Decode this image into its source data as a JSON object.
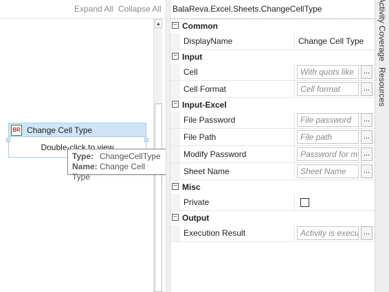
{
  "designer": {
    "expand_all": "Expand All",
    "collapse_all": "Collapse All",
    "activity": {
      "icon_text": "BR",
      "title": "Change Cell Type",
      "body": "Double-click to view"
    },
    "tooltip": {
      "type_key": "Type:",
      "type_val": "ChangeCellType",
      "name_key": "Name:",
      "name_val": "Change Cell Type"
    }
  },
  "properties": {
    "title": "BalaReva.Excel.Sheets.ChangeCellType",
    "categories": {
      "common": "Common",
      "input": "Input",
      "input_excel": "Input-Excel",
      "misc": "Misc",
      "output": "Output"
    },
    "rows": {
      "display_name": {
        "label": "DisplayName",
        "value": "Change Cell Type"
      },
      "cell": {
        "label": "Cell",
        "placeholder": "With quots like"
      },
      "cell_format": {
        "label": "Cell Format",
        "placeholder": "Cell format"
      },
      "file_password": {
        "label": "File Password",
        "placeholder": "File password"
      },
      "file_path": {
        "label": "File Path",
        "placeholder": "File path"
      },
      "modify_password": {
        "label": "Modify Password",
        "placeholder": "Password for m"
      },
      "sheet_name": {
        "label": "Sheet Name",
        "placeholder": "Sheet Name"
      },
      "private": {
        "label": "Private",
        "checked": false
      },
      "execution_result": {
        "label": "Execution Result",
        "placeholder": "Activity is execu"
      }
    },
    "ellipsis": "..."
  },
  "side_tabs": {
    "coverage": "Activity Coverage",
    "resources": "Resources"
  }
}
